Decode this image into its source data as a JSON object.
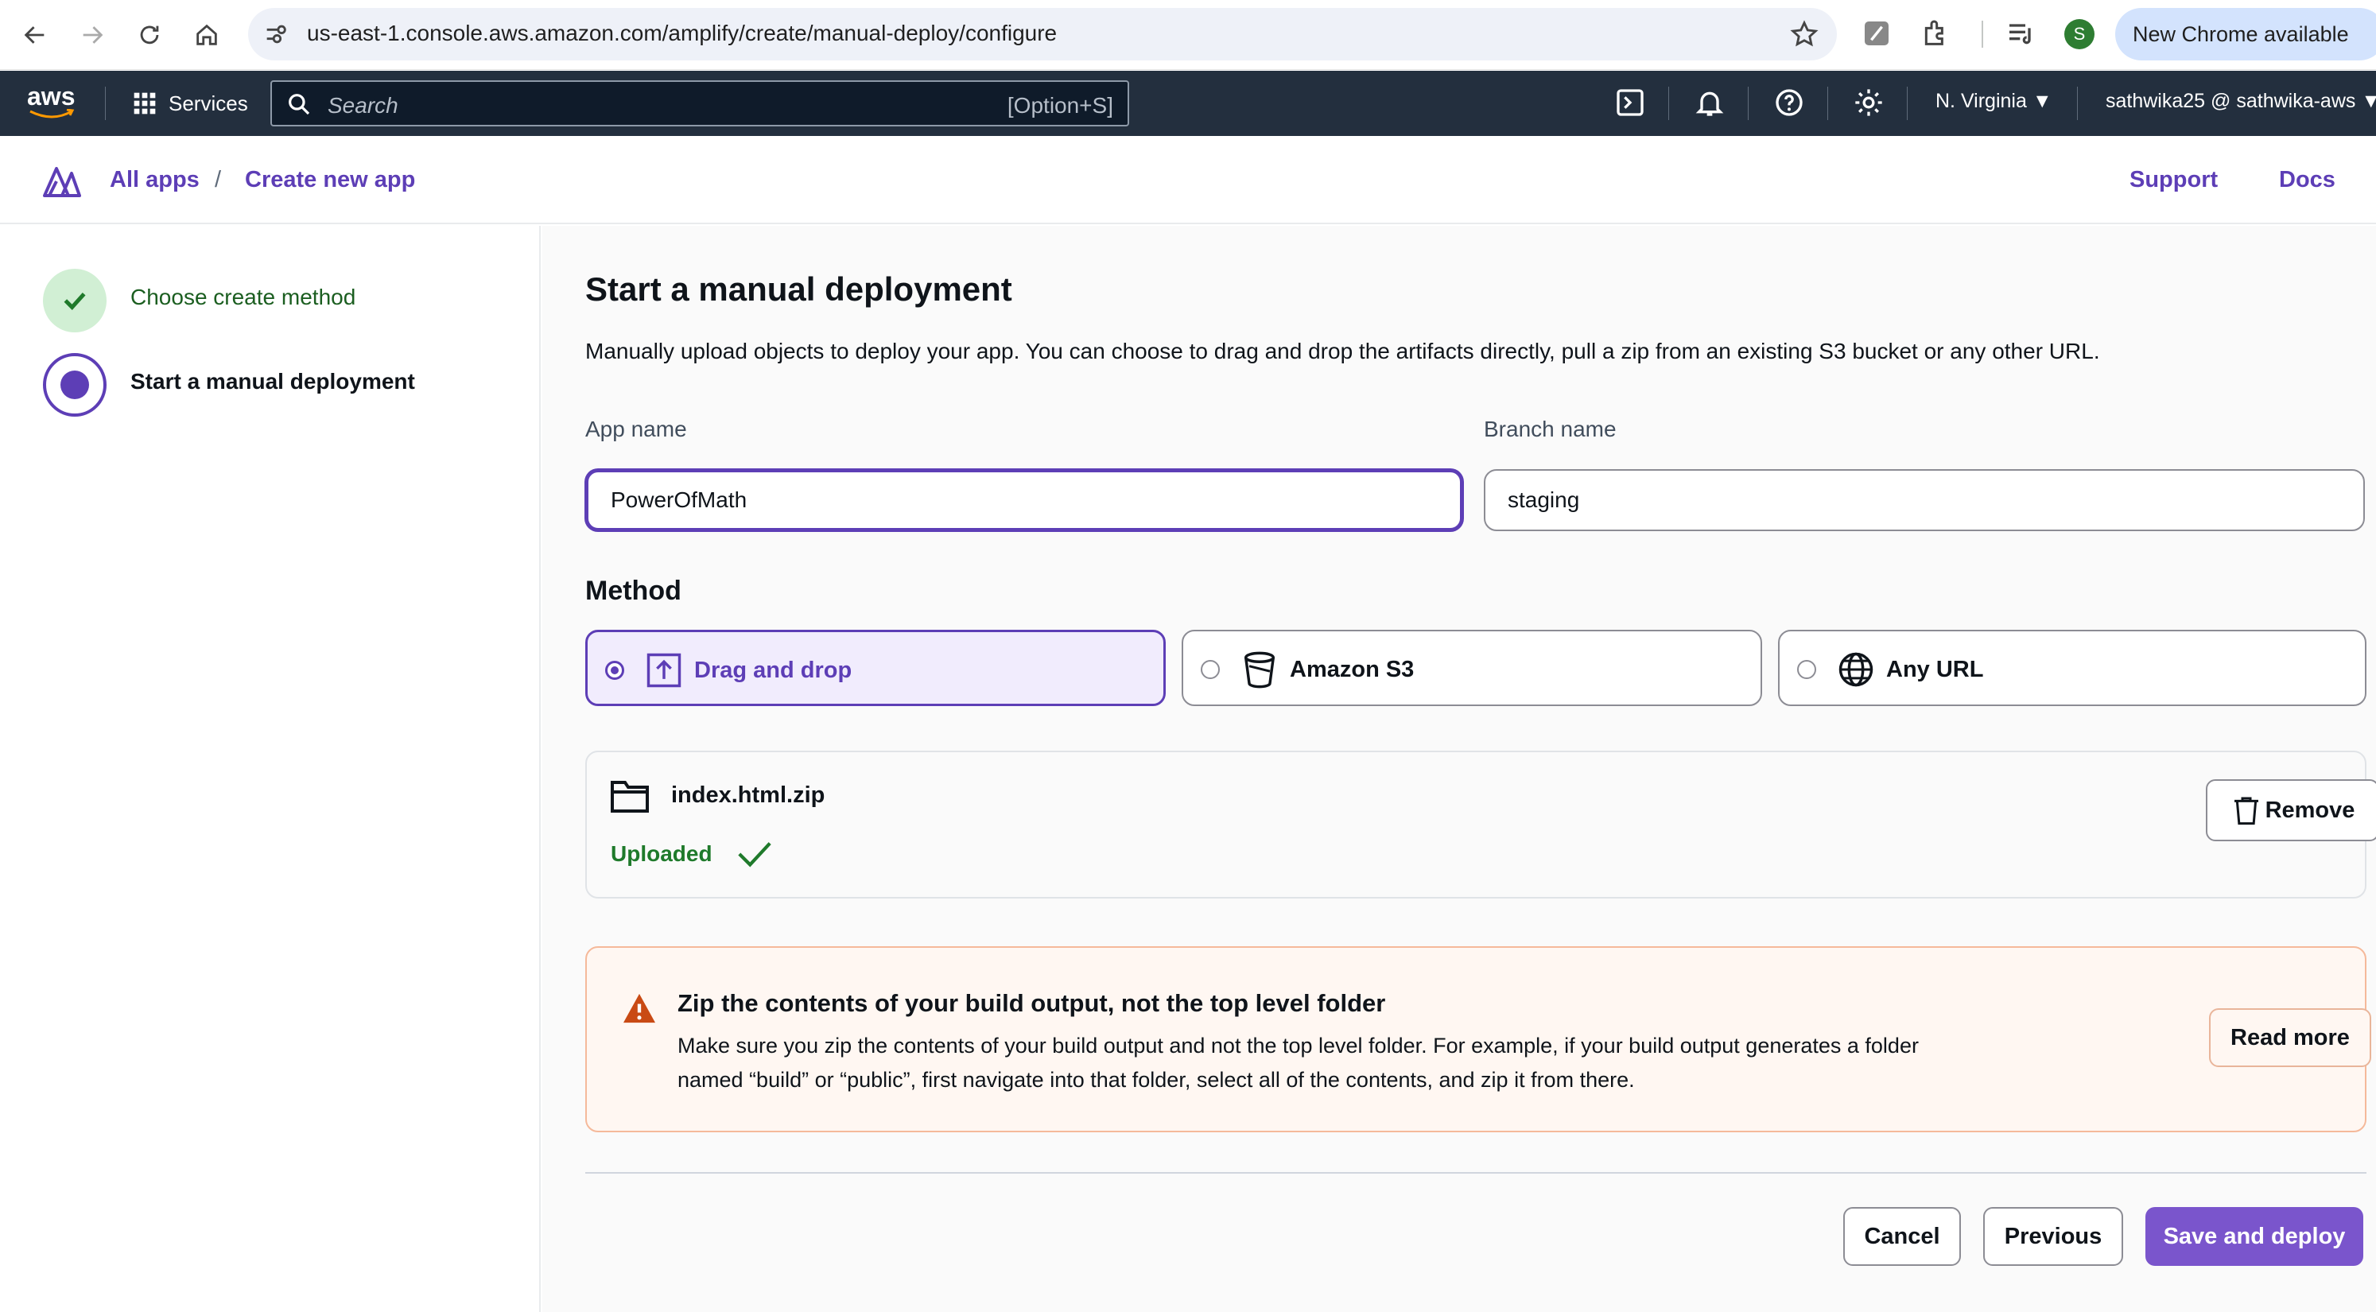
{
  "browser": {
    "url": "us-east-1.console.aws.amazon.com/amplify/create/manual-deploy/configure",
    "profile_initial": "S",
    "new_chrome": "New Chrome available"
  },
  "aws_nav": {
    "logo": "aws",
    "services_label": "Services",
    "search_placeholder": "Search",
    "search_shortcut": "[Option+S]",
    "region": "N. Virginia ▼",
    "account": "sathwika25 @ sathwika-aws ▼"
  },
  "breadcrumb": {
    "items": [
      "All apps",
      "Create new app"
    ],
    "separator": "/",
    "support": "Support",
    "docs": "Docs"
  },
  "steps": [
    {
      "label": "Choose create method",
      "state": "complete"
    },
    {
      "label": "Start a manual deployment",
      "state": "active"
    }
  ],
  "form": {
    "title": "Start a manual deployment",
    "description": "Manually upload objects to deploy your app. You can choose to drag and drop the artifacts directly, pull a zip from an existing S3 bucket or any other URL.",
    "app_name_label": "App name",
    "app_name_value": "PowerOfMath",
    "branch_name_label": "Branch name",
    "branch_name_value": "staging",
    "method_heading": "Method",
    "methods": [
      {
        "label": "Drag and drop",
        "icon": "upload-icon",
        "selected": true
      },
      {
        "label": "Amazon S3",
        "icon": "bucket-icon",
        "selected": false
      },
      {
        "label": "Any URL",
        "icon": "globe-icon",
        "selected": false
      }
    ]
  },
  "file": {
    "name": "index.html.zip",
    "status": "Uploaded",
    "remove_label": "Remove"
  },
  "alert": {
    "title": "Zip the contents of your build output, not the top level folder",
    "body": "Make sure you zip the contents of your build output and not the top level folder. For example, if your build output generates a folder named “build” or “public”, first navigate into that folder, select all of the contents, and zip it from there.",
    "action": "Read more"
  },
  "footer": {
    "cancel": "Cancel",
    "previous": "Previous",
    "save": "Save and deploy"
  },
  "colors": {
    "accent": "#5d3eb6",
    "primary_button": "#7a55cc",
    "success": "#1f7a2b",
    "nav_bg": "#232f3e",
    "warning": "#c94a14"
  }
}
